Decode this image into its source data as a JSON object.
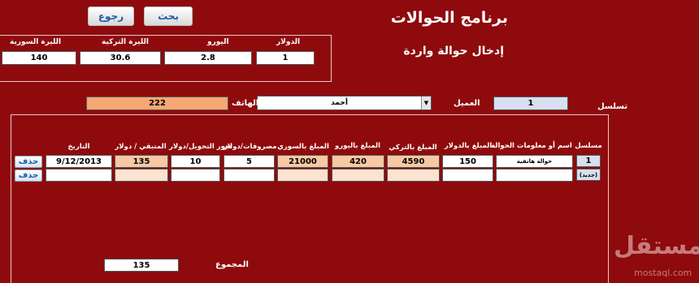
{
  "header": {
    "search_label": "بحث",
    "back_label": "رجوع",
    "title": "برنامج الحوالات",
    "subtitle": "إدخال حوالة واردة"
  },
  "rates": {
    "dollar_label": "الدولار",
    "euro_label": "اليورو",
    "lira_tr_label": "الليرة التركية",
    "lira_sy_label": "الليرة السورية",
    "dollar_value": "1",
    "euro_value": "2.8",
    "lira_tr_value": "30.6",
    "lira_sy_value": "140"
  },
  "customer": {
    "serial_label": "تسلسل",
    "client_label": "العميل",
    "client_value": "1",
    "name_value": "أحمد",
    "phone_label": "الهاتف",
    "phone_value": "222"
  },
  "table": {
    "headers": {
      "serial": "مسلسل",
      "name": "اسم أو معلومات الحوالة",
      "usd": "المبلغ بالدولار",
      "try": "المبلغ بالتركي",
      "eur": "المبلغ باليورو",
      "syp": "المبلغ بالسوري",
      "expenses": "مصروفات/دولار",
      "fees": "اجور التحويل/دولار",
      "remaining": "المتبقي / دولار",
      "date": "التاريخ"
    },
    "rows": [
      {
        "serial": "1",
        "name": "حوالة هاتفية",
        "usd": "150",
        "try": "4590",
        "eur": "420",
        "syp": "21000",
        "expenses": "5",
        "fees": "10",
        "remaining": "135",
        "date": "9/12/2013",
        "delete": "حذف"
      },
      {
        "serial": "(جديد)",
        "name": "",
        "usd": "",
        "try": "",
        "eur": "",
        "syp": "",
        "expenses": "",
        "fees": "",
        "remaining": "",
        "date": "",
        "delete": "حذف"
      }
    ]
  },
  "footer": {
    "total_label": "المجموع",
    "total_value": "135"
  },
  "watermark": {
    "arabic": "مستقل",
    "latin": "mostaql.com"
  }
}
